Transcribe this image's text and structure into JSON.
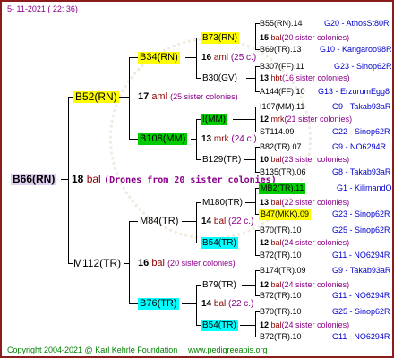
{
  "header": {
    "date": "5- 11-2021 ( 22: 36)"
  },
  "root": {
    "name": "B66(RN)",
    "generation": "18",
    "mark": "bal",
    "drones_note": "(Drones from 20 sister colonies)"
  },
  "level1": [
    {
      "name": "B52(RN)",
      "generation": "17",
      "mark": "aml",
      "sisters": "(25 sister colonies)"
    },
    {
      "name": "M112(TR)",
      "generation": "16",
      "mark": "bal",
      "sisters": "(20 sister colonies)"
    }
  ],
  "level2": [
    {
      "name": "B34(RN)",
      "highlight": "#ffff00",
      "generation": "16",
      "mark": "aml",
      "sisters": "(25 c.)"
    },
    {
      "name": "B30(GV)"
    },
    {
      "name": "B108(MM)",
      "highlight": "#00cc00",
      "generation": "13",
      "mark": "mrk",
      "sisters": "(24 c.)"
    },
    {
      "name": "B129(TR)"
    },
    {
      "name": "M84(TR)",
      "generation": "14",
      "mark": "bal",
      "sisters": "(22 c.)"
    },
    {
      "name": "B54(TR)",
      "highlight": "#00ffff"
    },
    {
      "name": "B76(TR)",
      "highlight": "#00ffff",
      "generation": "14",
      "mark": "bal",
      "sisters": "(22 c.)"
    },
    {
      "name": "B54(TR)",
      "highlight": "#00ffff"
    }
  ],
  "level3": [
    {
      "name": "B73(RN)",
      "highlight": "#ffff00",
      "generation": "15",
      "mark": "bal",
      "sisters": "(20 sister colonies)"
    },
    {
      "name": "B69(TR).13",
      "group": "G10 - Kangaroo98R"
    },
    {
      "name": "B307(FF).11",
      "group": "G23 - Sinop62R"
    },
    {
      "name": "",
      "generation": "13",
      "mark": "hbt",
      "sisters": "(16 sister colonies)"
    },
    {
      "name": "I(MM)",
      "highlight": "#00cc00"
    },
    {
      "name": "",
      "generation": "12",
      "mark": "mrk",
      "sisters": "(21 sister colonies)"
    },
    {
      "name": "B82(TR).07",
      "group": "G9 - NO6294R"
    },
    {
      "name": "",
      "generation": "10",
      "mark": "bal",
      "sisters": "(23 sister colonies)"
    },
    {
      "name": "M180(TR)"
    },
    {
      "name": "",
      "generation": "13",
      "mark": "bal",
      "sisters": "(22 sister colonies)"
    },
    {
      "name": "B70(TR).10",
      "group": "G25 - Sinop62R"
    },
    {
      "name": "",
      "generation": "12",
      "mark": "bal",
      "sisters": "(24 sister colonies)"
    },
    {
      "name": "B79(TR)"
    },
    {
      "name": "",
      "generation": "12",
      "mark": "bal",
      "sisters": "(24 sister colonies)"
    },
    {
      "name": "B70(TR).10",
      "group": "G25 - Sinop62R"
    },
    {
      "name": "",
      "generation": "12",
      "mark": "bal",
      "sisters": "(24 sister colonies)"
    }
  ],
  "level4": [
    {
      "name": "B55(RN).14",
      "group": "G20 - AthosSt80R"
    },
    {
      "name": "A144(FF).10",
      "group": "G13 - ErzurumEgg8"
    },
    {
      "name": "I107(MM).11",
      "group": "G9 - Takab93aR"
    },
    {
      "name": "ST114.09",
      "group": "G22 - Sinop62R"
    },
    {
      "name": "B135(TR).06",
      "group": "G8 - Takab93aR"
    },
    {
      "name": "MB2(TR).11",
      "highlight": "#00cc00",
      "group": "G1 - KilimandO"
    },
    {
      "name": "B47(MKK).09",
      "highlight": "#ffff00",
      "group": "G23 - Sinop62R"
    },
    {
      "name": "B72(TR).10",
      "group": "G11 - NO6294R"
    },
    {
      "name": "B174(TR).09",
      "group": "G9 - Takab93aR"
    },
    {
      "name": "B72(TR).10",
      "group": "G11 - NO6294R"
    },
    {
      "name": "B72(TR).10",
      "group": "G11 - NO6294R"
    }
  ],
  "footer": {
    "copyright": "Copyright 2004-2021 @ Karl Kehrle Foundation",
    "website": "www.pedigreeapis.org"
  }
}
